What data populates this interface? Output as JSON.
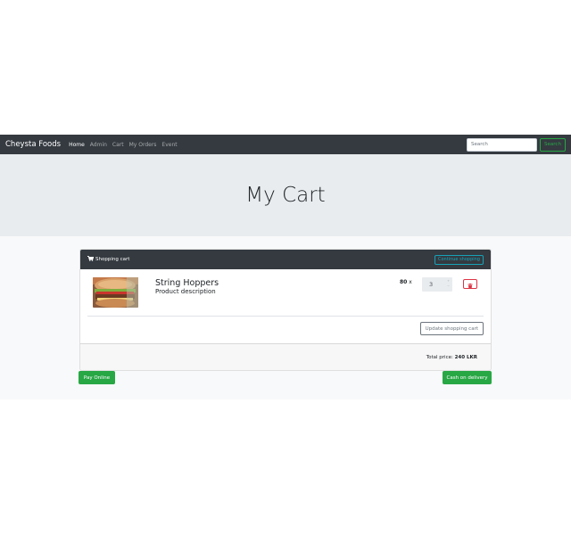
{
  "navbar": {
    "brand": "Cheysta Foods",
    "links": [
      "Home",
      "Admin",
      "Cart",
      "My Orders",
      "Event"
    ],
    "active": "Home",
    "search_placeholder": "Search",
    "search_button": "Search"
  },
  "jumbotron": {
    "title": "My Cart"
  },
  "cart": {
    "header_title": "Shopping cart",
    "continue_button": "Continue shopping",
    "items": [
      {
        "name": "String Hoppers",
        "description": "Product description",
        "price": "80",
        "times": "x",
        "quantity": "3"
      }
    ],
    "update_button": "Update shopping cart",
    "total_label": "Total price:",
    "total_value": "240 LKR"
  },
  "actions": {
    "pay_online": "Pay Online",
    "cash_on_delivery": "Cash on delivery"
  },
  "icons": {
    "cart": "cart-icon",
    "delete": "trash-icon",
    "product_image": "burger-photo"
  },
  "colors": {
    "navbar": "#343a40",
    "jumbotron": "#e9ecef",
    "success": "#28a745",
    "info": "#17a2b8",
    "danger": "#dc3545"
  }
}
